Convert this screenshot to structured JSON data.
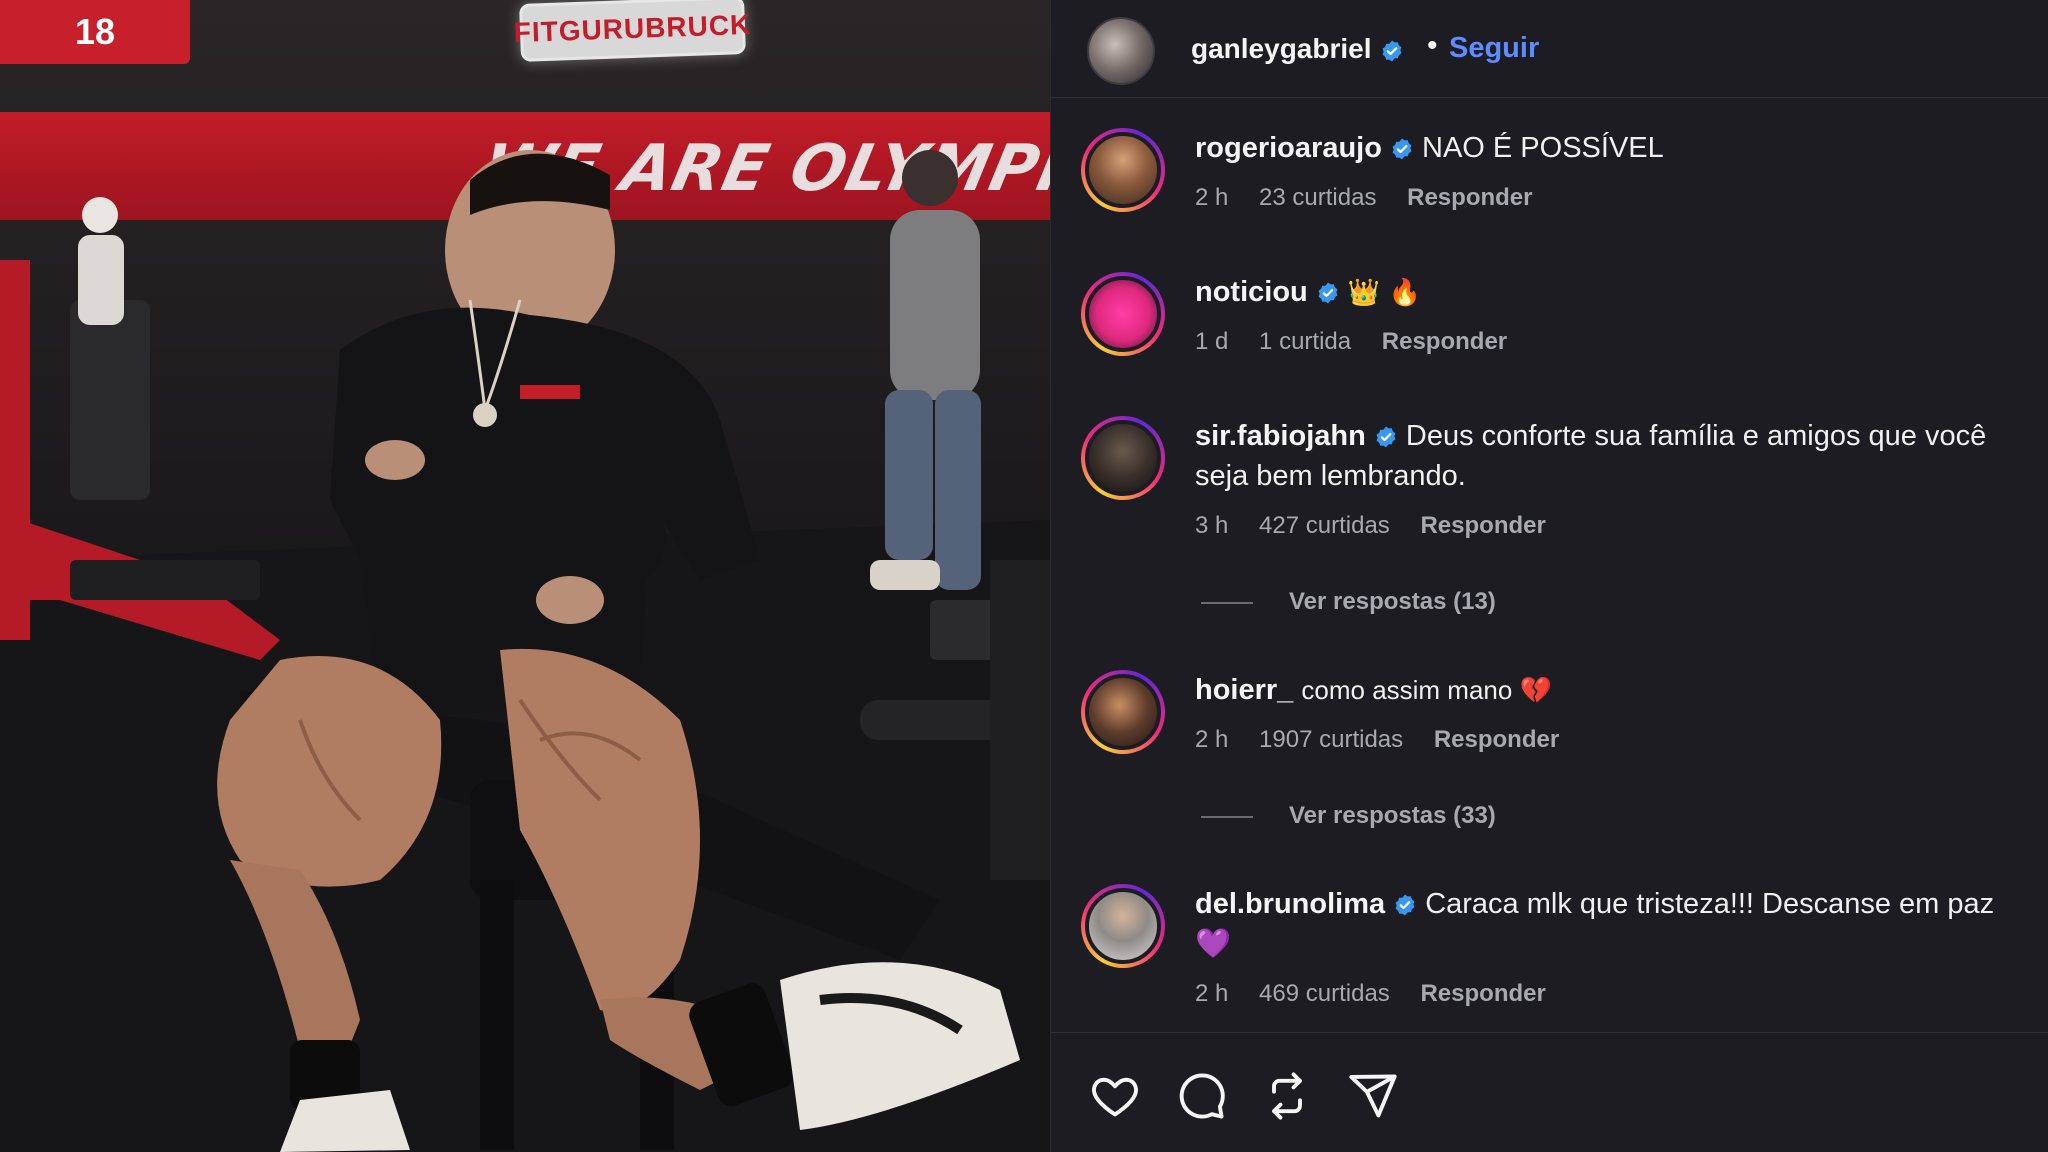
{
  "photo": {
    "sign_text": "FITGURUBRUCK",
    "banner_text": "WE ARE OLYMPIA",
    "scoreboard_number": "18"
  },
  "post": {
    "author": "ganleygabriel",
    "separator": "•",
    "follow_label": "Seguir"
  },
  "comments": [
    {
      "user": "rogerioaraujo",
      "verified": true,
      "text": "NAO É POSSÍVEL",
      "time": "2 h",
      "likes": "23 curtidas",
      "reply": "Responder"
    },
    {
      "user": "noticiou",
      "verified": true,
      "text": "👑 🔥",
      "time": "1 d",
      "likes": "1 curtida",
      "reply": "Responder"
    },
    {
      "user": "sir.fabiojahn",
      "verified": true,
      "text": "Deus conforte sua família e amigos que você seja bem lembrando.",
      "time": "3 h",
      "likes": "427 curtidas",
      "reply": "Responder",
      "view_replies": "Ver respostas (13)"
    },
    {
      "user": "hoierr_",
      "verified": false,
      "text": "como assim mano 💔",
      "time": "2 h",
      "likes": "1907 curtidas",
      "reply": "Responder",
      "view_replies": "Ver respostas (33)"
    },
    {
      "user": "del.brunolima",
      "verified": true,
      "text": "Caraca mlk que tristeza!!! Descanse em paz 💜",
      "time": "2 h",
      "likes": "469 curtidas",
      "reply": "Responder"
    }
  ],
  "icons": {
    "like": "heart-icon",
    "comment": "comment-bubble-icon",
    "repost": "repost-icon",
    "share": "send-icon"
  },
  "colors": {
    "panel_bg": "#1c1c22",
    "follow": "#5c8cff",
    "verified": "#3897f0",
    "meta_text": "#a8a8b0"
  }
}
